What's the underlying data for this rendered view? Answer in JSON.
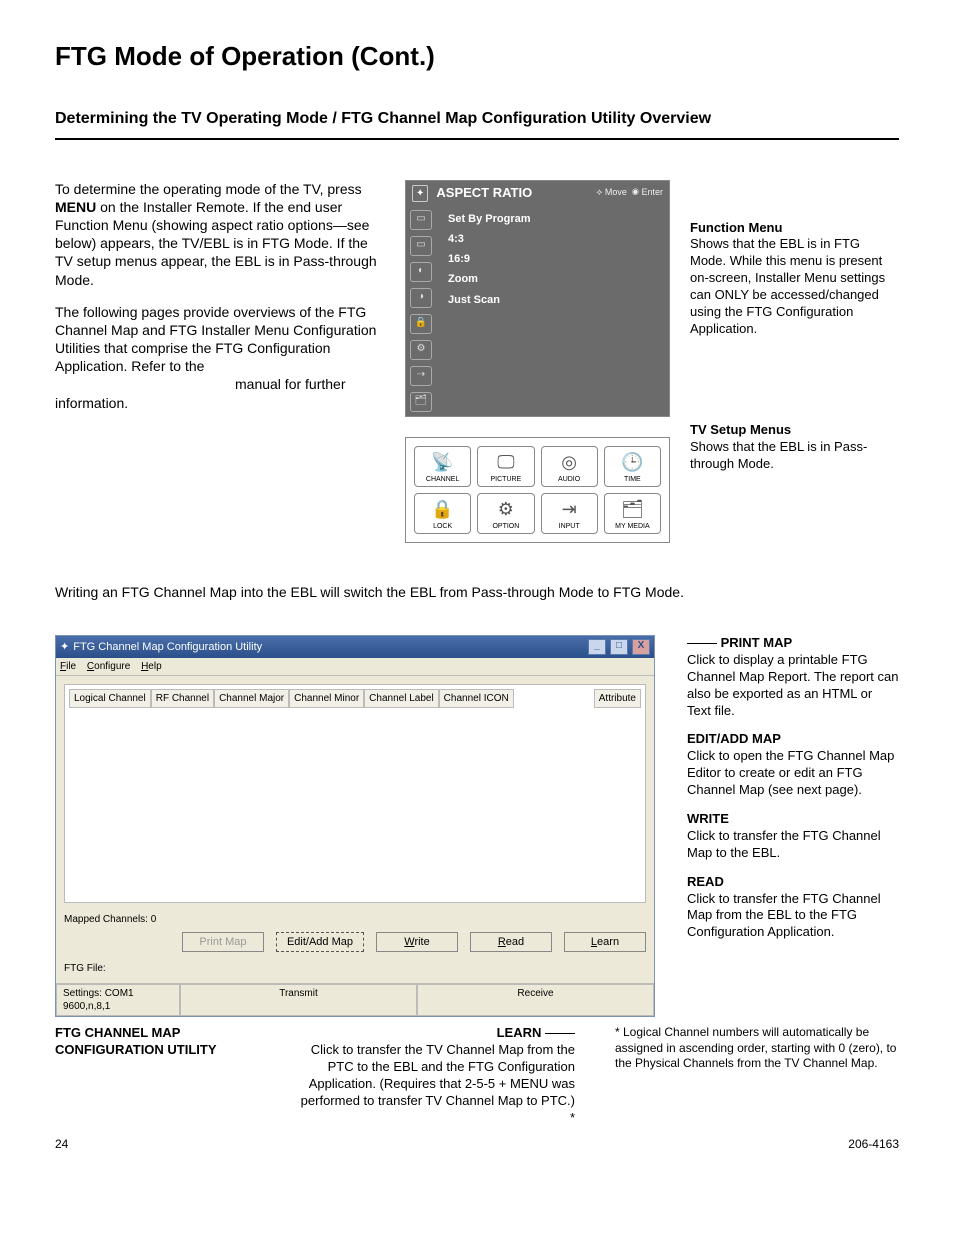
{
  "page": {
    "title": "FTG Mode of Operation (Cont.)",
    "subtitle": "Determining the TV Operating Mode / FTG Channel Map Configuration Utility Overview",
    "intro_p1a": "To determine the operating mode of the TV, press ",
    "intro_p1b": "MENU",
    "intro_p1c": " on the Installer Remote. If the end user Function Menu (showing aspect ratio options—see below) appears, the TV/EBL is in FTG Mode. If the TV setup menus appear, the EBL is in Pass-through Mode.",
    "intro_p2": "The following pages provide overviews of the FTG Channel Map and FTG Installer Menu Configuration Utilities that comprise the FTG Configuration Application. Refer to the",
    "intro_p2_tail": "manual for further information.",
    "note_line": "Writing an FTG Channel Map into the EBL will switch the EBL from Pass-through Mode to FTG Mode.",
    "page_number": "24",
    "doc_number": "206-4163"
  },
  "osd": {
    "title": "ASPECT RATIO",
    "hint_move": "Move",
    "hint_enter": "Enter",
    "items": [
      "Set By Program",
      "4:3",
      "16:9",
      "Zoom",
      "Just Scan"
    ]
  },
  "function_menu_annot": {
    "title": "Function Menu",
    "body": "Shows that the EBL is in FTG Mode. While this menu is present on-screen, Installer Menu settings can ONLY be accessed/changed using the FTG Configuration Application."
  },
  "tv_setup": {
    "cells": [
      "CHANNEL",
      "PICTURE",
      "AUDIO",
      "TIME",
      "LOCK",
      "OPTION",
      "INPUT",
      "MY MEDIA"
    ],
    "annot_title": "TV Setup Menus",
    "annot_body": "Shows that the EBL is in Pass-through Mode."
  },
  "app": {
    "title": "FTG Channel Map Configuration Utility",
    "menus": [
      "File",
      "Configure",
      "Help"
    ],
    "columns": [
      "Logical Channel",
      "RF Channel",
      "Channel Major",
      "Channel Minor",
      "Channel Label",
      "Channel ICON"
    ],
    "attribute_col": "Attribute",
    "mapped": "Mapped Channels: 0",
    "ftg_file": "FTG File:",
    "buttons": {
      "print": "Print Map",
      "edit": "Edit/Add Map",
      "write": "Write",
      "read": "Read",
      "learn": "Learn"
    },
    "status": {
      "settings": "Settings: COM1 9600,n,8,1",
      "transmit": "Transmit",
      "receive": "Receive"
    },
    "win_min": "_",
    "win_max": "□",
    "win_close": "X"
  },
  "annots": {
    "print_t": "PRINT MAP",
    "print_b": "Click to display a printable FTG Channel Map Report. The report can also be exported as an HTML or Text file.",
    "edit_t": "EDIT/ADD MAP",
    "edit_b": "Click to open the FTG Channel Map Editor to create or edit an FTG Channel Map (see next page).",
    "write_t": "WRITE",
    "write_b": "Click to transfer the FTG Channel Map to the EBL.",
    "read_t": "READ",
    "read_b": "Click to transfer the FTG Channel Map from the EBL to the FTG Configuration Application.",
    "learn_t": "LEARN",
    "learn_b": "Click to transfer the TV Channel Map from the PTC to the EBL and the FTG Configuration Application. (Requires that 2-5-5 + MENU was performed to transfer TV Channel Map to PTC.) *",
    "util_t1": "FTG CHANNEL MAP",
    "util_t2": "CONFIGURATION UTILITY",
    "footnote": "* Logical Channel numbers will automatically be assigned in ascending order, starting with 0 (zero), to the Physical Channels from the TV Channel Map."
  }
}
